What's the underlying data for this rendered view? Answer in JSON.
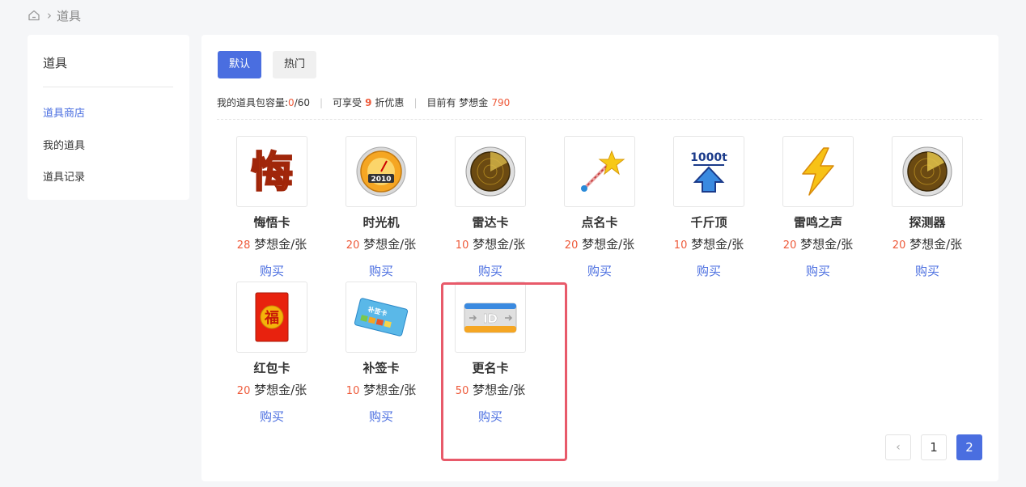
{
  "breadcrumb": {
    "icon": "home-icon",
    "separator": "›",
    "current": "道具"
  },
  "sidebar": {
    "title": "道具",
    "items": [
      {
        "label": "道具商店",
        "active": true
      },
      {
        "label": "我的道具",
        "active": false
      },
      {
        "label": "道具记录",
        "active": false
      }
    ]
  },
  "tabs": [
    {
      "label": "默认",
      "active": true
    },
    {
      "label": "热门",
      "active": false
    }
  ],
  "info": {
    "capacity_label": "我的道具包容量:",
    "capacity_used": "0",
    "capacity_total": "/60",
    "discount_prefix": "可享受",
    "discount_value": "9",
    "discount_suffix": "折优惠",
    "balance_prefix": "目前有 梦想金",
    "balance_value": "790"
  },
  "items": [
    {
      "name": "悔悟卡",
      "price": "28",
      "unit": "梦想金/张",
      "buy": "购买",
      "icon": "regret-card-icon"
    },
    {
      "name": "时光机",
      "price": "20",
      "unit": "梦想金/张",
      "buy": "购买",
      "icon": "time-machine-icon"
    },
    {
      "name": "雷达卡",
      "price": "10",
      "unit": "梦想金/张",
      "buy": "购买",
      "icon": "radar-icon"
    },
    {
      "name": "点名卡",
      "price": "20",
      "unit": "梦想金/张",
      "buy": "购买",
      "icon": "magic-wand-icon"
    },
    {
      "name": "千斤顶",
      "price": "10",
      "unit": "梦想金/张",
      "buy": "购买",
      "icon": "jack-icon",
      "icon_text": "1000t"
    },
    {
      "name": "雷鸣之声",
      "price": "20",
      "unit": "梦想金/张",
      "buy": "购买",
      "icon": "lightning-icon"
    },
    {
      "name": "探测器",
      "price": "20",
      "unit": "梦想金/张",
      "buy": "购买",
      "icon": "detector-icon"
    },
    {
      "name": "红包卡",
      "price": "20",
      "unit": "梦想金/张",
      "buy": "购买",
      "icon": "red-envelope-icon",
      "icon_text": "福"
    },
    {
      "name": "补签卡",
      "price": "10",
      "unit": "梦想金/张",
      "buy": "购买",
      "icon": "makeup-sign-card-icon",
      "icon_text": "补签卡"
    },
    {
      "name": "更名卡",
      "price": "50",
      "unit": "梦想金/张",
      "buy": "购买",
      "icon": "rename-card-icon",
      "icon_text": "ID"
    }
  ],
  "pagination": {
    "prev": "‹",
    "pages": [
      "1",
      "2"
    ],
    "current": "2"
  },
  "colors": {
    "accent": "#4a6ee0",
    "price": "#ee5a3a",
    "highlight": "#e85a6a"
  }
}
